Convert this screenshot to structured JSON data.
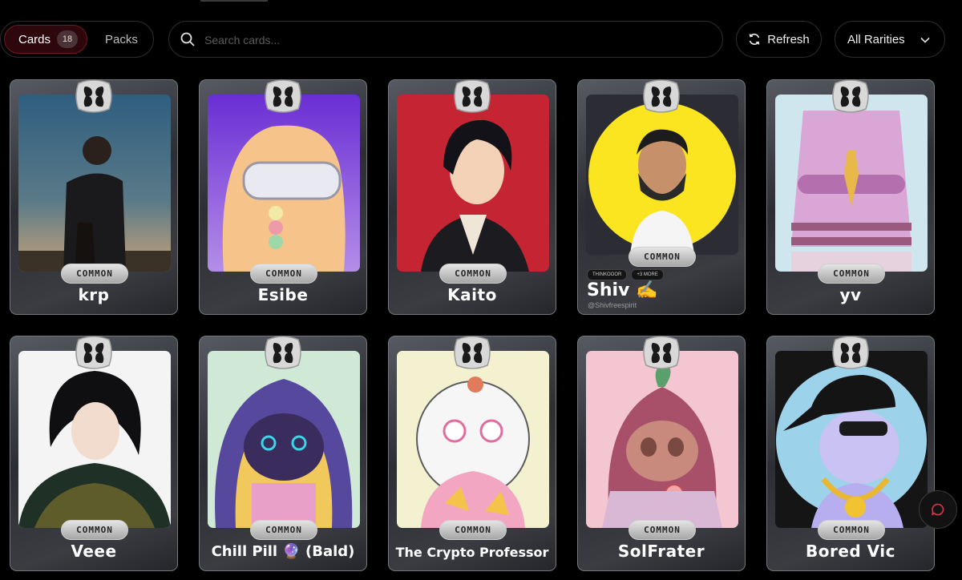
{
  "toolbar": {
    "cards_label": "Cards",
    "cards_count": "18",
    "packs_label": "Packs",
    "search_placeholder": "Search cards...",
    "refresh_label": "Refresh",
    "rarity_filter": "All Rarities"
  },
  "cards": [
    {
      "name": "krp",
      "rarity": "COMMON"
    },
    {
      "name": "Esibe",
      "rarity": "COMMON"
    },
    {
      "name": "Kaito",
      "rarity": "COMMON"
    },
    {
      "name": "Shiv ✍️",
      "rarity": "COMMON",
      "tags": [
        "THINKOOOR",
        "+3 MORE"
      ],
      "handle": "@Shivfreespirit"
    },
    {
      "name": "yv",
      "rarity": "COMMON"
    },
    {
      "name": "Veee",
      "rarity": "COMMON"
    },
    {
      "name": "Chill Pill 🔮 (Bald)",
      "rarity": "COMMON"
    },
    {
      "name": "The Crypto Professor",
      "rarity": "COMMON"
    },
    {
      "name": "SolFrater",
      "rarity": "COMMON"
    },
    {
      "name": "Bored Vic",
      "rarity": "COMMON"
    }
  ],
  "colors": {
    "accent": "#6e1a26",
    "background": "#000000"
  },
  "icons": [
    "search-icon",
    "refresh-icon",
    "chevron-down-icon",
    "chat-icon",
    "brand-logo-icon"
  ]
}
